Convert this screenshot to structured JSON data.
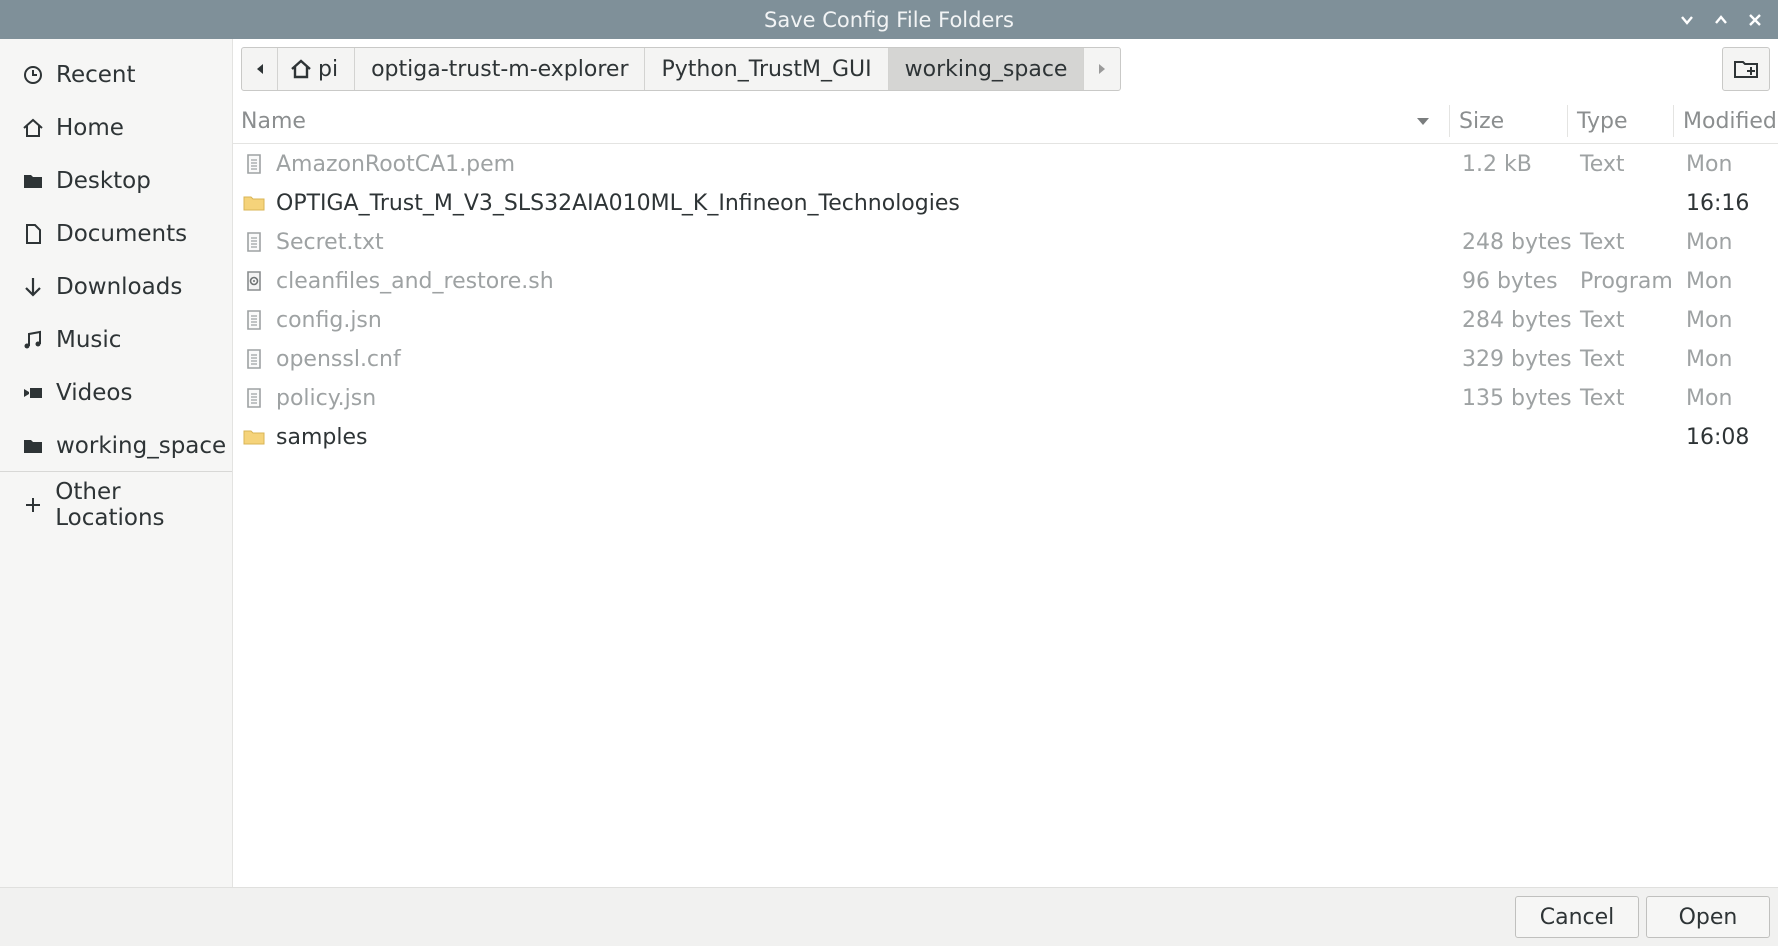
{
  "window": {
    "title": "Save Config File Folders"
  },
  "sidebar": {
    "items": [
      {
        "label": "Recent",
        "icon": "clock-icon"
      },
      {
        "label": "Home",
        "icon": "home-icon"
      },
      {
        "label": "Desktop",
        "icon": "folder-icon"
      },
      {
        "label": "Documents",
        "icon": "document-icon"
      },
      {
        "label": "Downloads",
        "icon": "download-arrow-icon"
      },
      {
        "label": "Music",
        "icon": "music-note-icon"
      },
      {
        "label": "Videos",
        "icon": "video-icon"
      },
      {
        "label": "working_space",
        "icon": "folder-icon"
      }
    ],
    "other_locations": "Other Locations"
  },
  "pathbar": {
    "segments": [
      "pi",
      "optiga-trust-m-explorer",
      "Python_TrustM_GUI",
      "working_space"
    ],
    "active": "working_space"
  },
  "columns": {
    "name": "Name",
    "size": "Size",
    "type": "Type",
    "modified": "Modified"
  },
  "files": [
    {
      "name": "AmazonRootCA1.pem",
      "size": "1.2 kB",
      "type": "Text",
      "modified": "Mon",
      "kind": "text-file-icon"
    },
    {
      "name": "OPTIGA_Trust_M_V3_SLS32AIA010ML_K_Infineon_Technologies",
      "size": "",
      "type": "",
      "modified": "16:16",
      "kind": "folder-icon"
    },
    {
      "name": "Secret.txt",
      "size": "248 bytes",
      "type": "Text",
      "modified": "Mon",
      "kind": "text-file-icon"
    },
    {
      "name": "cleanfiles_and_restore.sh",
      "size": "96 bytes",
      "type": "Program",
      "modified": "Mon",
      "kind": "program-file-icon"
    },
    {
      "name": "config.jsn",
      "size": "284 bytes",
      "type": "Text",
      "modified": "Mon",
      "kind": "text-file-icon"
    },
    {
      "name": "openssl.cnf",
      "size": "329 bytes",
      "type": "Text",
      "modified": "Mon",
      "kind": "text-file-icon"
    },
    {
      "name": "policy.jsn",
      "size": "135 bytes",
      "type": "Text",
      "modified": "Mon",
      "kind": "text-file-icon"
    },
    {
      "name": "samples",
      "size": "",
      "type": "",
      "modified": "16:08",
      "kind": "folder-icon"
    }
  ],
  "footer": {
    "cancel_label": "Cancel",
    "open_label": "Open"
  },
  "colors": {
    "titlebar": "#7f9099",
    "folder": "#f5d37a",
    "dim_text": "#9ea2a3"
  }
}
